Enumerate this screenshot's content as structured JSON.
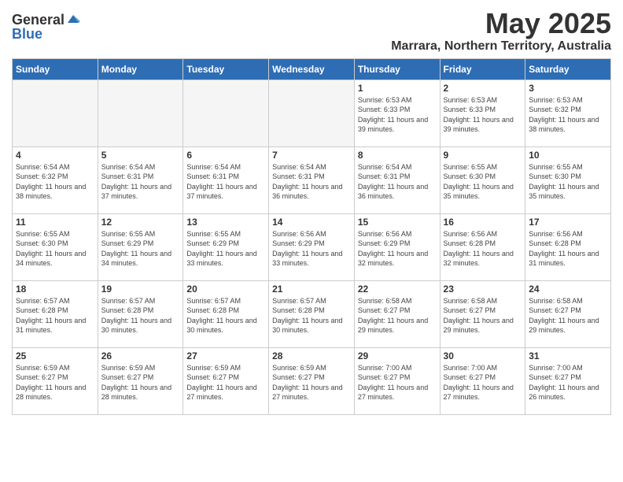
{
  "logo": {
    "general": "General",
    "blue": "Blue"
  },
  "title": {
    "month": "May 2025",
    "location": "Marrara, Northern Territory, Australia"
  },
  "header": {
    "days": [
      "Sunday",
      "Monday",
      "Tuesday",
      "Wednesday",
      "Thursday",
      "Friday",
      "Saturday"
    ]
  },
  "weeks": [
    [
      {
        "day": "",
        "sunrise": "",
        "sunset": "",
        "daylight": "",
        "empty": true
      },
      {
        "day": "",
        "sunrise": "",
        "sunset": "",
        "daylight": "",
        "empty": true
      },
      {
        "day": "",
        "sunrise": "",
        "sunset": "",
        "daylight": "",
        "empty": true
      },
      {
        "day": "",
        "sunrise": "",
        "sunset": "",
        "daylight": "",
        "empty": true
      },
      {
        "day": "1",
        "sunrise": "Sunrise: 6:53 AM",
        "sunset": "Sunset: 6:33 PM",
        "daylight": "Daylight: 11 hours and 39 minutes."
      },
      {
        "day": "2",
        "sunrise": "Sunrise: 6:53 AM",
        "sunset": "Sunset: 6:33 PM",
        "daylight": "Daylight: 11 hours and 39 minutes."
      },
      {
        "day": "3",
        "sunrise": "Sunrise: 6:53 AM",
        "sunset": "Sunset: 6:32 PM",
        "daylight": "Daylight: 11 hours and 38 minutes."
      }
    ],
    [
      {
        "day": "4",
        "sunrise": "Sunrise: 6:54 AM",
        "sunset": "Sunset: 6:32 PM",
        "daylight": "Daylight: 11 hours and 38 minutes."
      },
      {
        "day": "5",
        "sunrise": "Sunrise: 6:54 AM",
        "sunset": "Sunset: 6:31 PM",
        "daylight": "Daylight: 11 hours and 37 minutes."
      },
      {
        "day": "6",
        "sunrise": "Sunrise: 6:54 AM",
        "sunset": "Sunset: 6:31 PM",
        "daylight": "Daylight: 11 hours and 37 minutes."
      },
      {
        "day": "7",
        "sunrise": "Sunrise: 6:54 AM",
        "sunset": "Sunset: 6:31 PM",
        "daylight": "Daylight: 11 hours and 36 minutes."
      },
      {
        "day": "8",
        "sunrise": "Sunrise: 6:54 AM",
        "sunset": "Sunset: 6:31 PM",
        "daylight": "Daylight: 11 hours and 36 minutes."
      },
      {
        "day": "9",
        "sunrise": "Sunrise: 6:55 AM",
        "sunset": "Sunset: 6:30 PM",
        "daylight": "Daylight: 11 hours and 35 minutes."
      },
      {
        "day": "10",
        "sunrise": "Sunrise: 6:55 AM",
        "sunset": "Sunset: 6:30 PM",
        "daylight": "Daylight: 11 hours and 35 minutes."
      }
    ],
    [
      {
        "day": "11",
        "sunrise": "Sunrise: 6:55 AM",
        "sunset": "Sunset: 6:30 PM",
        "daylight": "Daylight: 11 hours and 34 minutes."
      },
      {
        "day": "12",
        "sunrise": "Sunrise: 6:55 AM",
        "sunset": "Sunset: 6:29 PM",
        "daylight": "Daylight: 11 hours and 34 minutes."
      },
      {
        "day": "13",
        "sunrise": "Sunrise: 6:55 AM",
        "sunset": "Sunset: 6:29 PM",
        "daylight": "Daylight: 11 hours and 33 minutes."
      },
      {
        "day": "14",
        "sunrise": "Sunrise: 6:56 AM",
        "sunset": "Sunset: 6:29 PM",
        "daylight": "Daylight: 11 hours and 33 minutes."
      },
      {
        "day": "15",
        "sunrise": "Sunrise: 6:56 AM",
        "sunset": "Sunset: 6:29 PM",
        "daylight": "Daylight: 11 hours and 32 minutes."
      },
      {
        "day": "16",
        "sunrise": "Sunrise: 6:56 AM",
        "sunset": "Sunset: 6:28 PM",
        "daylight": "Daylight: 11 hours and 32 minutes."
      },
      {
        "day": "17",
        "sunrise": "Sunrise: 6:56 AM",
        "sunset": "Sunset: 6:28 PM",
        "daylight": "Daylight: 11 hours and 31 minutes."
      }
    ],
    [
      {
        "day": "18",
        "sunrise": "Sunrise: 6:57 AM",
        "sunset": "Sunset: 6:28 PM",
        "daylight": "Daylight: 11 hours and 31 minutes."
      },
      {
        "day": "19",
        "sunrise": "Sunrise: 6:57 AM",
        "sunset": "Sunset: 6:28 PM",
        "daylight": "Daylight: 11 hours and 30 minutes."
      },
      {
        "day": "20",
        "sunrise": "Sunrise: 6:57 AM",
        "sunset": "Sunset: 6:28 PM",
        "daylight": "Daylight: 11 hours and 30 minutes."
      },
      {
        "day": "21",
        "sunrise": "Sunrise: 6:57 AM",
        "sunset": "Sunset: 6:28 PM",
        "daylight": "Daylight: 11 hours and 30 minutes."
      },
      {
        "day": "22",
        "sunrise": "Sunrise: 6:58 AM",
        "sunset": "Sunset: 6:27 PM",
        "daylight": "Daylight: 11 hours and 29 minutes."
      },
      {
        "day": "23",
        "sunrise": "Sunrise: 6:58 AM",
        "sunset": "Sunset: 6:27 PM",
        "daylight": "Daylight: 11 hours and 29 minutes."
      },
      {
        "day": "24",
        "sunrise": "Sunrise: 6:58 AM",
        "sunset": "Sunset: 6:27 PM",
        "daylight": "Daylight: 11 hours and 29 minutes."
      }
    ],
    [
      {
        "day": "25",
        "sunrise": "Sunrise: 6:59 AM",
        "sunset": "Sunset: 6:27 PM",
        "daylight": "Daylight: 11 hours and 28 minutes."
      },
      {
        "day": "26",
        "sunrise": "Sunrise: 6:59 AM",
        "sunset": "Sunset: 6:27 PM",
        "daylight": "Daylight: 11 hours and 28 minutes."
      },
      {
        "day": "27",
        "sunrise": "Sunrise: 6:59 AM",
        "sunset": "Sunset: 6:27 PM",
        "daylight": "Daylight: 11 hours and 27 minutes."
      },
      {
        "day": "28",
        "sunrise": "Sunrise: 6:59 AM",
        "sunset": "Sunset: 6:27 PM",
        "daylight": "Daylight: 11 hours and 27 minutes."
      },
      {
        "day": "29",
        "sunrise": "Sunrise: 7:00 AM",
        "sunset": "Sunset: 6:27 PM",
        "daylight": "Daylight: 11 hours and 27 minutes."
      },
      {
        "day": "30",
        "sunrise": "Sunrise: 7:00 AM",
        "sunset": "Sunset: 6:27 PM",
        "daylight": "Daylight: 11 hours and 27 minutes."
      },
      {
        "day": "31",
        "sunrise": "Sunrise: 7:00 AM",
        "sunset": "Sunset: 6:27 PM",
        "daylight": "Daylight: 11 hours and 26 minutes."
      }
    ]
  ]
}
